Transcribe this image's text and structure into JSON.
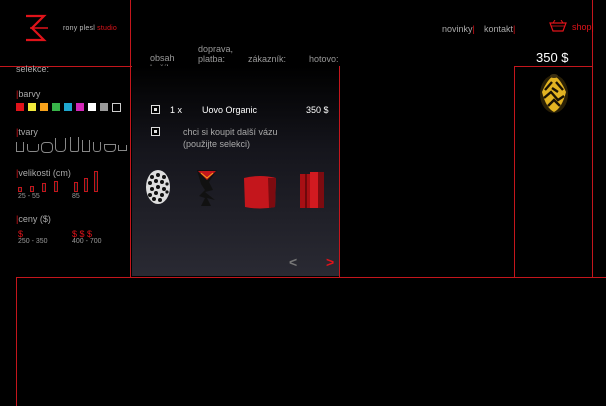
{
  "brand": {
    "name": "rony plesl",
    "suffix": "studio"
  },
  "topnav": {
    "novinky": "novinky",
    "kontakt": "kontakt",
    "shop": "shop"
  },
  "price_total": "350 $",
  "filters": {
    "selekce": "selekce:",
    "barvy": "barvy",
    "colors": [
      "#e0131a",
      "#f2e93c",
      "#f7a21b",
      "#38b449",
      "#1ea7cf",
      "#d428b8",
      "#ffffff",
      "#9a9a9a",
      "#000000"
    ],
    "tvary": "tvary",
    "velikosti": "velikosti (cm)",
    "size_labels": [
      "25 - 55",
      "85"
    ],
    "ceny": "ceny ($)",
    "price_ranges": [
      {
        "symbol": "$",
        "label": "250 - 350"
      },
      {
        "symbol": "$ $ $",
        "label": "400 - 700"
      }
    ]
  },
  "steps": [
    {
      "line1": "obsah",
      "line2": "košíku:"
    },
    {
      "line1": "doprava,",
      "line2": "platba:"
    },
    {
      "line1": "zákazník:",
      "line2": ""
    },
    {
      "line1": "hotovo:",
      "line2": ""
    }
  ],
  "cart": {
    "item": {
      "qty": "1 x",
      "name": "Uovo Organic",
      "price": "350 $"
    },
    "prompt_line1": "chci si koupit  další vázu",
    "prompt_line2": "(použijte selekci)",
    "products": [
      "net-vase",
      "spiky-vase",
      "red-box-vase",
      "red-tall-vase"
    ],
    "prev": "<",
    "next": ">"
  }
}
